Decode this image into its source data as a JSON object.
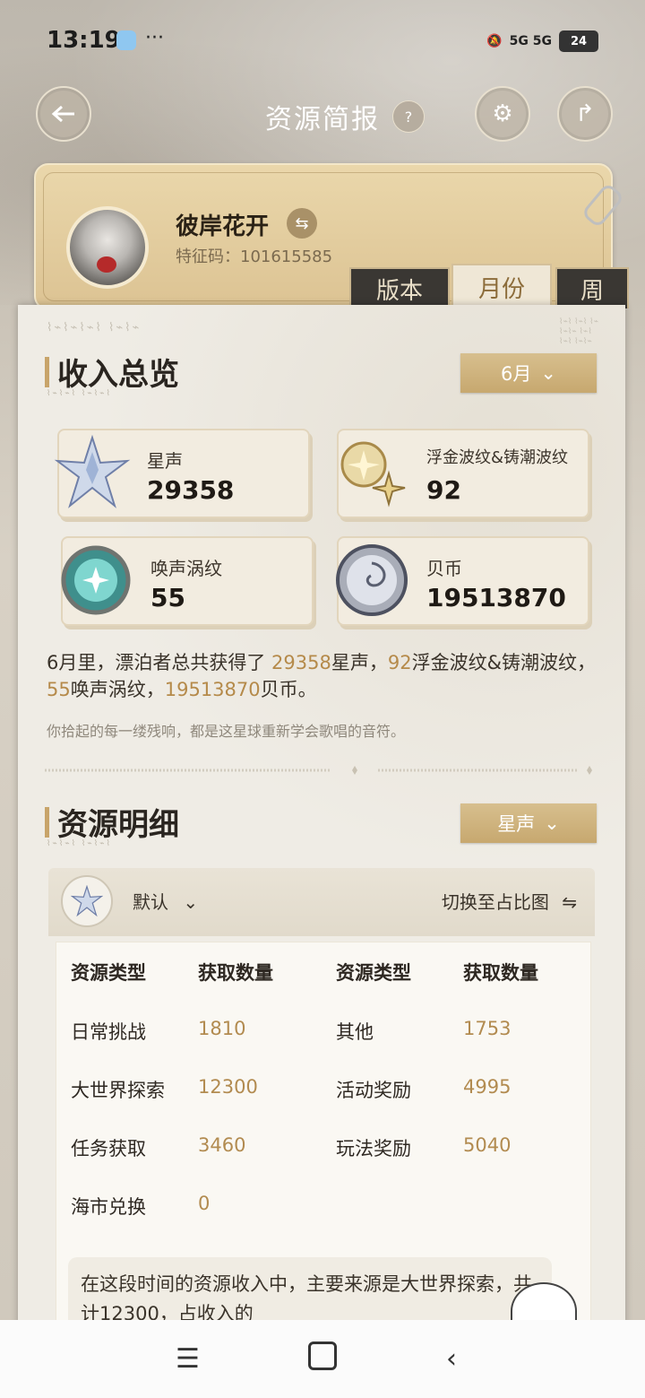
{
  "status_bar": {
    "time": "13:19",
    "dots": "···",
    "battery": "24",
    "network": "5G 5G"
  },
  "header": {
    "title": "资源简报",
    "help": "?"
  },
  "profile": {
    "name": "彼岸花开",
    "uid_label": "特征码：101615585"
  },
  "tabs": [
    {
      "label": "版本",
      "active": false
    },
    {
      "label": "月份",
      "active": true
    },
    {
      "label": "周",
      "active": false
    }
  ],
  "income": {
    "title": "收入总览",
    "month_select": "6月",
    "resources": [
      {
        "label": "星声",
        "value": "29358",
        "icon": "star-crystal-icon"
      },
      {
        "label": "浮金波纹&铸潮波纹",
        "value": "92",
        "icon": "golden-wave-icon"
      },
      {
        "label": "唤声涡纹",
        "value": "55",
        "icon": "teal-orb-icon"
      },
      {
        "label": "贝币",
        "value": "19513870",
        "icon": "shell-coin-icon"
      }
    ],
    "summary": {
      "p1": "6月里，漂泊者总共获得了 ",
      "v1": "29358",
      "p2": "星声，",
      "v2": "92",
      "p3": "浮金波纹&铸潮波纹，",
      "v3": "55",
      "p4": "唤声涡纹，",
      "v4": "19513870",
      "p5": "贝币。"
    },
    "quote": "你拾起的每一缕残响，都是这星球重新学会歌唱的音符。"
  },
  "details": {
    "title": "资源明细",
    "resource_select": "星声",
    "default_label": "默认",
    "switch_label": "切换至占比图",
    "headers": [
      "资源类型",
      "获取数量",
      "资源类型",
      "获取数量"
    ],
    "rows": [
      [
        "日常挑战",
        "1810",
        "其他",
        "1753"
      ],
      [
        "大世界探索",
        "12300",
        "活动奖励",
        "4995"
      ],
      [
        "任务获取",
        "3460",
        "玩法奖励",
        "5040"
      ],
      [
        "海市兑换",
        "0",
        "",
        ""
      ]
    ],
    "note": "在这段时间的资源收入中，主要来源是大世界探索，共计12300，占收入的"
  },
  "colors": {
    "accent": "#c8a46a",
    "highlight": "#b58a4a",
    "card_bg": "#efece5"
  }
}
